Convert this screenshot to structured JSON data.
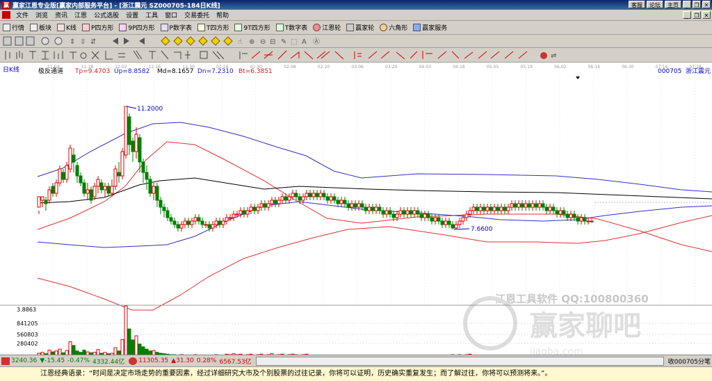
{
  "window": {
    "title": "赢家江恩专业版[赢家内部服务平台] - [浙江震元  SZ000705-184日K线]",
    "title_buttons": [
      "客服",
      "论坛",
      "主页"
    ]
  },
  "menu": [
    "文件",
    "浏览",
    "资讯",
    "江恩",
    "公式选股",
    "设置",
    "工具",
    "窗口",
    "交易委托",
    "帮助"
  ],
  "toolbar1": [
    "行情",
    "板块",
    "K线",
    "P四方形",
    "9P四方形",
    "P数字表",
    "T四方形",
    "9T四方形",
    "T数字表",
    "江恩轮",
    "赢家轮",
    "六角形",
    "赢家服务"
  ],
  "chart": {
    "period_label": "日K线",
    "indicator": {
      "name": "极反通道",
      "tp": "Tp=9.4703",
      "up": "Up=8.8582",
      "md": "Md=8.1657",
      "dn": "Dn=7.2310",
      "bt": "Bt=6.3851"
    },
    "stock": {
      "code": "000705",
      "name": "浙江震元"
    },
    "date_ticks": [
      "11-04",
      "11-18",
      "12-02",
      "12-16",
      "12-30",
      "01-16",
      "01-30",
      "02-08",
      "02-20",
      "03-06",
      "03-20",
      "04-03",
      "04-18",
      "05-05",
      "05-19",
      "06-02",
      "06-16",
      "06-30",
      "07-14",
      "07-28"
    ],
    "high_label": "11.2000",
    "low_label": "7.6600",
    "volume_scale": [
      "3.8863",
      "841205",
      "560803",
      "280402"
    ],
    "watermark_top": "江恩工具软件  QQ:100800360",
    "watermark_logo": "赢家聊吧",
    "watermark_url": "jiaoba.com",
    "colors": {
      "up": "#e00000",
      "down": "#008000",
      "tp_bt": "#e03030",
      "up_dn": "#3030c0",
      "md": "#000000"
    }
  },
  "status": {
    "sh_index": "3240.36",
    "sh_change": "▼-15.45",
    "sh_pct": "-0.47%",
    "sh_amount": "4332.44亿",
    "sz_index": "11305.35",
    "sz_change": "▲31.30",
    "sz_pct": "0.28%",
    "sz_amount": "6567.53亿",
    "right_label": "收000705分笔"
  },
  "quote": "江恩经典语录：“时间是决定市场走势的重要因素，经过详细研究大市及个别股票的过往记录，你将可以证明，历史确实重复发生；而了解过往，你将可以预测将来。”。"
}
